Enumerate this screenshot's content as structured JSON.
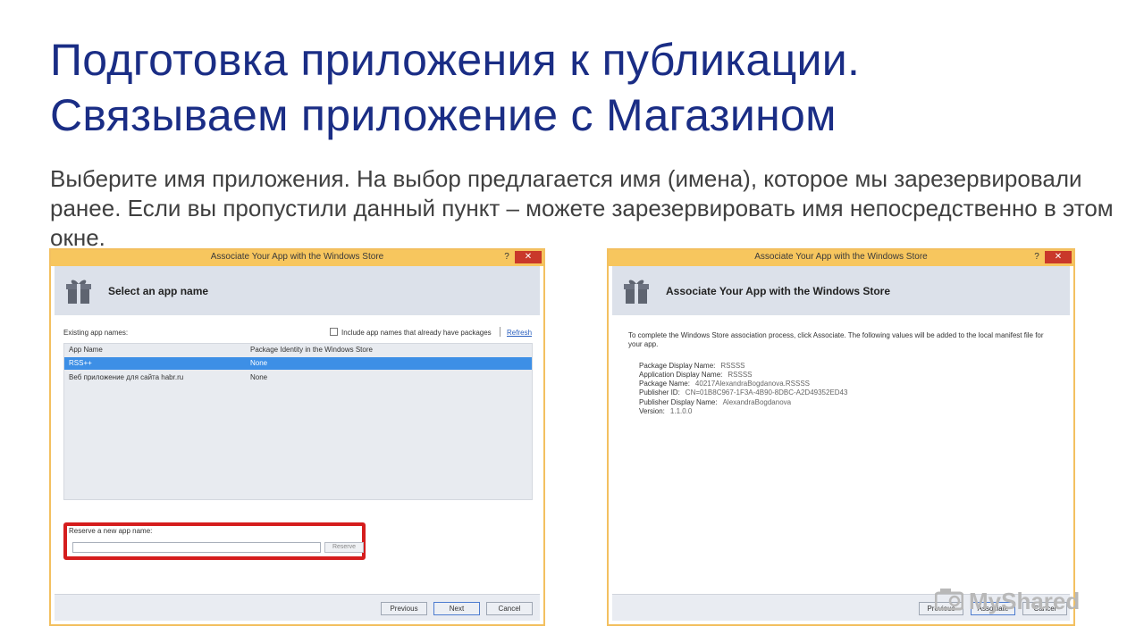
{
  "slide": {
    "title_line1": "Подготовка приложения к публикации.",
    "title_line2": "Связываем приложение с Магазином",
    "body": "Выберите имя приложения. На выбор предлагается имя (имена), которое мы зарезервировали ранее. Если вы пропустили данный пункт – можете зарезервировать имя непосредственно в этом окне."
  },
  "dialog_left": {
    "window_title": "Associate Your App with the Windows Store",
    "help_label": "?",
    "close_label": "✕",
    "heading": "Select an app name",
    "existing_label": "Existing app names:",
    "include_checkbox_label": "Include app names that already have packages",
    "refresh_label": "Refresh",
    "columns": [
      "App Name",
      "Package Identity in the Windows Store"
    ],
    "rows": [
      {
        "name": "RSS++",
        "identity": "None",
        "selected": true
      },
      {
        "name": "Веб приложение для сайта habr.ru",
        "identity": "None",
        "selected": false
      }
    ],
    "reserve_label": "Reserve a new app name:",
    "reserve_input_value": "",
    "reserve_button": "Reserve",
    "buttons": {
      "previous": "Previous",
      "next": "Next",
      "cancel": "Cancel"
    }
  },
  "dialog_right": {
    "window_title": "Associate Your App with the Windows Store",
    "help_label": "?",
    "close_label": "✕",
    "heading": "Associate Your App with the Windows Store",
    "description": "To complete the Windows Store association process, click Associate. The following values will be added to the local manifest file for your app.",
    "fields": [
      {
        "label": "Package Display Name:",
        "value": "RSSSS"
      },
      {
        "label": "Application Display Name:",
        "value": "RSSSS"
      },
      {
        "label": "Package Name:",
        "value": "40217AlexandraBogdanova.RSSSS"
      },
      {
        "label": "Publisher ID:",
        "value": "CN=01B8C967-1F3A-4B90-8DBC-A2D49352ED43"
      },
      {
        "label": "Publisher Display Name:",
        "value": "AlexandraBogdanova"
      },
      {
        "label": "Version:",
        "value": "1.1.0.0"
      }
    ],
    "buttons": {
      "previous": "Previous",
      "associate": "Associate",
      "cancel": "Cancel"
    }
  },
  "watermark": {
    "text": "MyShared"
  },
  "colors": {
    "title": "#1a2d85",
    "body_text": "#404040",
    "titlebar": "#f7c65e",
    "selection": "#3d8fe6",
    "highlight_frame": "#d51d1d",
    "close_button": "#c9382a"
  }
}
